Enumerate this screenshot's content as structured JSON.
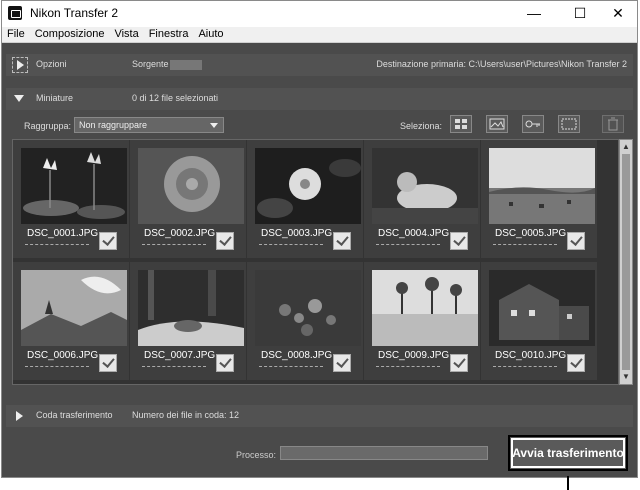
{
  "window": {
    "title": "Nikon Transfer 2",
    "controls": {
      "minimize": "—",
      "maximize": "☐",
      "close": "✕"
    }
  },
  "menu": [
    "File",
    "Composizione",
    "Vista",
    "Finestra",
    "Aiuto"
  ],
  "options_panel": {
    "label": "Opzioni",
    "source_label": "Sorgente",
    "destination": "Destinazione primaria: C:\\Users\\user\\Pictures\\Nikon Transfer 2"
  },
  "thumbnails_panel": {
    "label": "Miniature",
    "selected_count": "0 di 12 file selezionati",
    "group_label": "Raggruppa:",
    "group_value": "Non raggruppare",
    "select_label": "Seleziona:"
  },
  "thumbnails": [
    {
      "name": "DSC_0001.JPG",
      "checked": true,
      "subject": "water lilies"
    },
    {
      "name": "DSC_0002.JPG",
      "checked": true,
      "subject": "rose"
    },
    {
      "name": "DSC_0003.JPG",
      "checked": true,
      "subject": "white flower"
    },
    {
      "name": "DSC_0004.JPG",
      "checked": true,
      "subject": "mandarin duck"
    },
    {
      "name": "DSC_0005.JPG",
      "checked": true,
      "subject": "grazing field"
    },
    {
      "name": "DSC_0006.JPG",
      "checked": true,
      "subject": "mountain sky"
    },
    {
      "name": "DSC_0007.JPG",
      "checked": true,
      "subject": "forest stream"
    },
    {
      "name": "DSC_0008.JPG",
      "checked": true,
      "subject": "berries"
    },
    {
      "name": "DSC_0009.JPG",
      "checked": true,
      "subject": "palm beach"
    },
    {
      "name": "DSC_0010.JPG",
      "checked": true,
      "subject": "building at dusk"
    }
  ],
  "queue_panel": {
    "label": "Coda trasferimento",
    "queue_count": "Numero dei file in coda: 12"
  },
  "footer": {
    "process_label": "Processo:",
    "start_button": "Avvia trasferimento"
  },
  "colors": {
    "window_bg": "#4a4a4a",
    "panel_bg": "#525252",
    "highlight": "#000000"
  }
}
